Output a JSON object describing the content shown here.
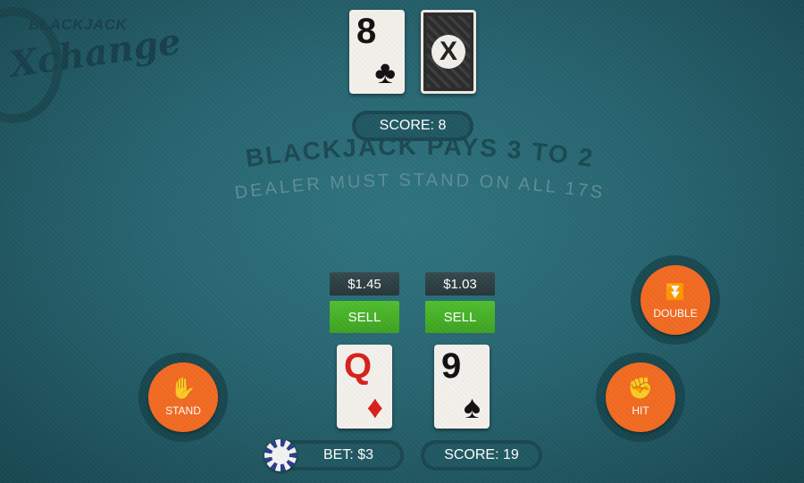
{
  "logo": {
    "line1": "BLACKJACK",
    "line2": "Xchange"
  },
  "dealer": {
    "cards": [
      {
        "rank": "8",
        "suit": "♣",
        "color": "black"
      }
    ],
    "hidden_card": {
      "emblem": "X"
    },
    "score_label": "SCORE: 8"
  },
  "table_text": {
    "line1": "BLACKJACK PAYS 3 TO 2",
    "line2": "DEALER MUST STAND ON ALL 17S"
  },
  "player": {
    "cards": [
      {
        "rank": "Q",
        "suit": "♦",
        "color": "red",
        "price": "$1.45",
        "sell_label": "SELL"
      },
      {
        "rank": "9",
        "suit": "♠",
        "color": "black",
        "price": "$1.03",
        "sell_label": "SELL"
      }
    ],
    "bet_label": "BET: $3",
    "score_label": "SCORE: 19"
  },
  "actions": {
    "stand": {
      "label": "STAND",
      "icon": "hand-stop-icon"
    },
    "double": {
      "label": "DOUBLE",
      "icon": "double-chevron-down-icon"
    },
    "hit": {
      "label": "HIT",
      "icon": "hand-tap-icon"
    }
  },
  "colors": {
    "felt": "#276570",
    "action_orange": "#f26a22",
    "sell_green": "#4fbf2f",
    "card_red": "#d8201c"
  }
}
